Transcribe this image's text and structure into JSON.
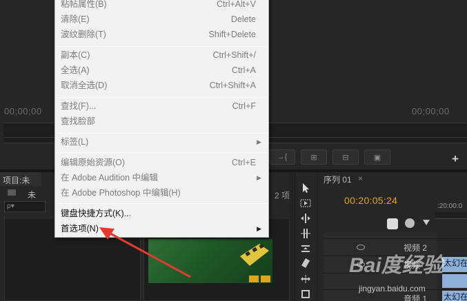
{
  "source_monitor": {
    "timecode_left": "00;00;00",
    "timecode_right": "00;00;00"
  },
  "transport_buttons": [
    "→{",
    "⊞",
    "⊟",
    "▣"
  ],
  "add_button": "+",
  "project_panel": {
    "tab_label": "项目:未",
    "name": "未",
    "item_count": "2 项",
    "search_placeholder": "ρ▾"
  },
  "tools": [
    "selection-tool",
    "track-select-tool",
    "ripple-edit-tool",
    "rolling-edit-tool",
    "rate-stretch-tool",
    "razor-tool",
    "slip-tool",
    "slide-tool",
    "pen-tool"
  ],
  "sequence_panel": {
    "tab_label": "序列 01",
    "close": "×",
    "timecode": "00:20:05:24",
    "ruler_timecode": ":20:00:0",
    "tracks": [
      {
        "label": "视频 2",
        "clip": ""
      },
      {
        "label": "视频",
        "clip": "太幻在"
      },
      {
        "label": "",
        "clip": ""
      },
      {
        "label": "音频 1",
        "clip": "太幻在"
      }
    ]
  },
  "context_menu": {
    "items": [
      {
        "label": "粘帖属性(B)",
        "shortcut": "Ctrl+Alt+V",
        "enabled": false,
        "submenu": false
      },
      {
        "label": "清除(E)",
        "shortcut": "Delete",
        "enabled": false,
        "submenu": false
      },
      {
        "label": "波纹删除(T)",
        "shortcut": "Shift+Delete",
        "enabled": false,
        "submenu": false
      },
      {
        "label": "副本(C)",
        "shortcut": "Ctrl+Shift+/",
        "enabled": false,
        "submenu": false
      },
      {
        "label": "全选(A)",
        "shortcut": "Ctrl+A",
        "enabled": false,
        "submenu": false
      },
      {
        "label": "取消全选(D)",
        "shortcut": "Ctrl+Shift+A",
        "enabled": false,
        "submenu": false
      },
      {
        "label": "查找(F)...",
        "shortcut": "Ctrl+F",
        "enabled": false,
        "submenu": false
      },
      {
        "label": "查找脸部",
        "shortcut": "",
        "enabled": false,
        "submenu": false
      },
      {
        "label": "标签(L)",
        "shortcut": "",
        "enabled": false,
        "submenu": true
      },
      {
        "label": "编辑原始资源(O)",
        "shortcut": "Ctrl+E",
        "enabled": false,
        "submenu": false
      },
      {
        "label": "在 Adobe Audition 中编辑",
        "shortcut": "",
        "enabled": false,
        "submenu": true
      },
      {
        "label": "在 Adobe Photoshop 中编辑(H)",
        "shortcut": "",
        "enabled": false,
        "submenu": false
      },
      {
        "label": "键盘快捷方式(K)...",
        "shortcut": "",
        "enabled": true,
        "submenu": false
      },
      {
        "label": "首选项(N)",
        "shortcut": "",
        "enabled": true,
        "submenu": true
      }
    ]
  },
  "watermark": {
    "logo": "Bai度经验",
    "url": "jingyan.baidu.com"
  },
  "colors": {
    "timecode_accent": "#e8a317",
    "annotation_arrow": "#e23b2e",
    "clip_blue": "#8fb0d8"
  }
}
